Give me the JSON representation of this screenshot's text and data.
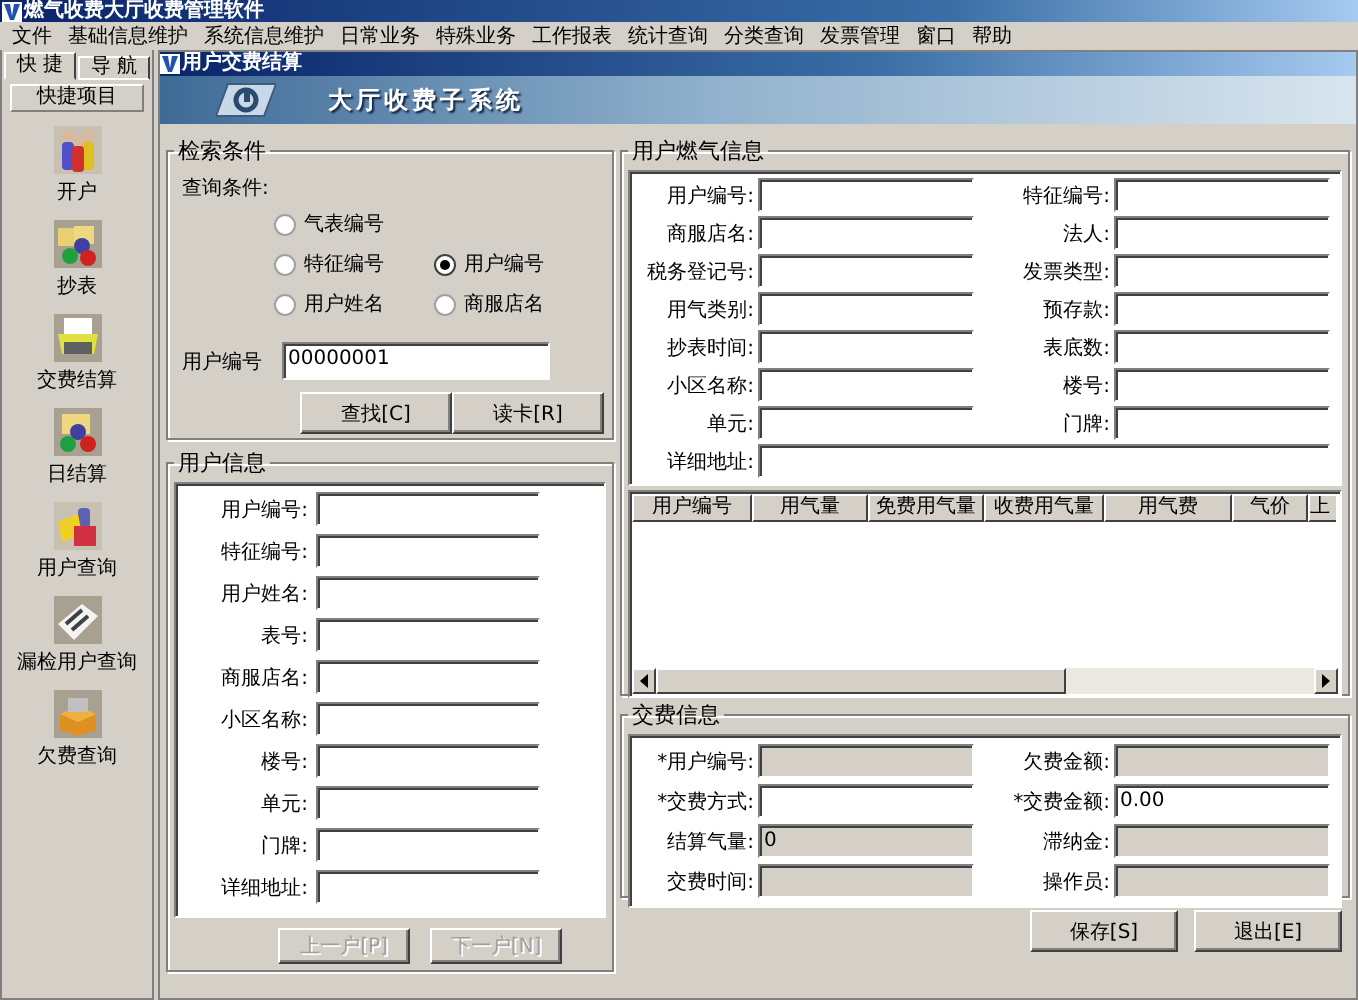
{
  "app": {
    "title": "燃气收费大厅收费管理软件"
  },
  "menu": [
    "文件",
    "基础信息维护",
    "系统信息维护",
    "日常业务",
    "特殊业务",
    "工作报表",
    "统计查询",
    "分类查询",
    "发票管理",
    "窗口",
    "帮助"
  ],
  "sidebar": {
    "tabs": [
      {
        "label": "快 捷",
        "selected": true
      },
      {
        "label": "导 航",
        "selected": false
      }
    ],
    "header": "快捷项目",
    "items": [
      {
        "label": "开户"
      },
      {
        "label": "抄表"
      },
      {
        "label": "交费结算"
      },
      {
        "label": "日结算"
      },
      {
        "label": "用户查询"
      },
      {
        "label": "漏检用户查询"
      },
      {
        "label": "欠费查询"
      }
    ]
  },
  "child_window": {
    "title": "用户交费结算",
    "banner": "大厅收费子系统"
  },
  "search": {
    "title": "检索条件",
    "prompt": "查询条件:",
    "options": [
      {
        "label": "气表编号",
        "selected": false
      },
      {
        "label": "特征编号",
        "selected": false
      },
      {
        "label": "用户编号",
        "selected": true
      },
      {
        "label": "用户姓名",
        "selected": false
      },
      {
        "label": "商服店名",
        "selected": false
      }
    ],
    "field_label": "用户编号",
    "field_value": "00000001",
    "buttons": [
      {
        "label": "查找[C]",
        "disabled": false
      },
      {
        "label": "读卡[R]",
        "disabled": false
      }
    ]
  },
  "user_info": {
    "title": "用户信息",
    "fields": [
      {
        "label": "用户编号:"
      },
      {
        "label": "特征编号:"
      },
      {
        "label": "用户姓名:"
      },
      {
        "label": "表号:"
      },
      {
        "label": "商服店名:"
      },
      {
        "label": "小区名称:"
      },
      {
        "label": "楼号:"
      },
      {
        "label": "单元:"
      },
      {
        "label": "门牌:"
      },
      {
        "label": "详细地址:"
      }
    ],
    "buttons": [
      {
        "label": "上一户[P]",
        "disabled": true
      },
      {
        "label": "下一户[N]",
        "disabled": true
      }
    ]
  },
  "gas_info": {
    "title": "用户燃气信息",
    "fields": [
      {
        "label": "用户编号:"
      },
      {
        "label": "特征编号:"
      },
      {
        "label": "商服店名:"
      },
      {
        "label": "法人:"
      },
      {
        "label": "税务登记号:"
      },
      {
        "label": "发票类型:"
      },
      {
        "label": "用气类别:"
      },
      {
        "label": "预存款:"
      },
      {
        "label": "抄表时间:"
      },
      {
        "label": "表底数:"
      },
      {
        "label": "小区名称:"
      },
      {
        "label": "楼号:"
      },
      {
        "label": "单元:"
      },
      {
        "label": "门牌:"
      }
    ],
    "address_label": "详细地址:",
    "table": {
      "columns": [
        "用户编号",
        "用气量",
        "免费用气量",
        "收费用气量",
        "用气费",
        "气价",
        "上"
      ]
    }
  },
  "payment": {
    "title": "交费信息",
    "fields": [
      {
        "label": "*用户编号:",
        "disabled": true
      },
      {
        "label": "欠费金额:",
        "disabled": true
      },
      {
        "label": "*交费方式:",
        "disabled": false
      },
      {
        "label": "*交费金额:",
        "value": "0.00",
        "disabled": false
      },
      {
        "label": "结算气量:",
        "value": "0",
        "disabled": true
      },
      {
        "label": "滞纳金:",
        "disabled": true
      },
      {
        "label": "交费时间:",
        "disabled": true
      },
      {
        "label": "操作员:",
        "disabled": true
      }
    ],
    "buttons": [
      {
        "label": "保存[S]",
        "disabled": false
      },
      {
        "label": "退出[E]",
        "disabled": false
      }
    ]
  }
}
